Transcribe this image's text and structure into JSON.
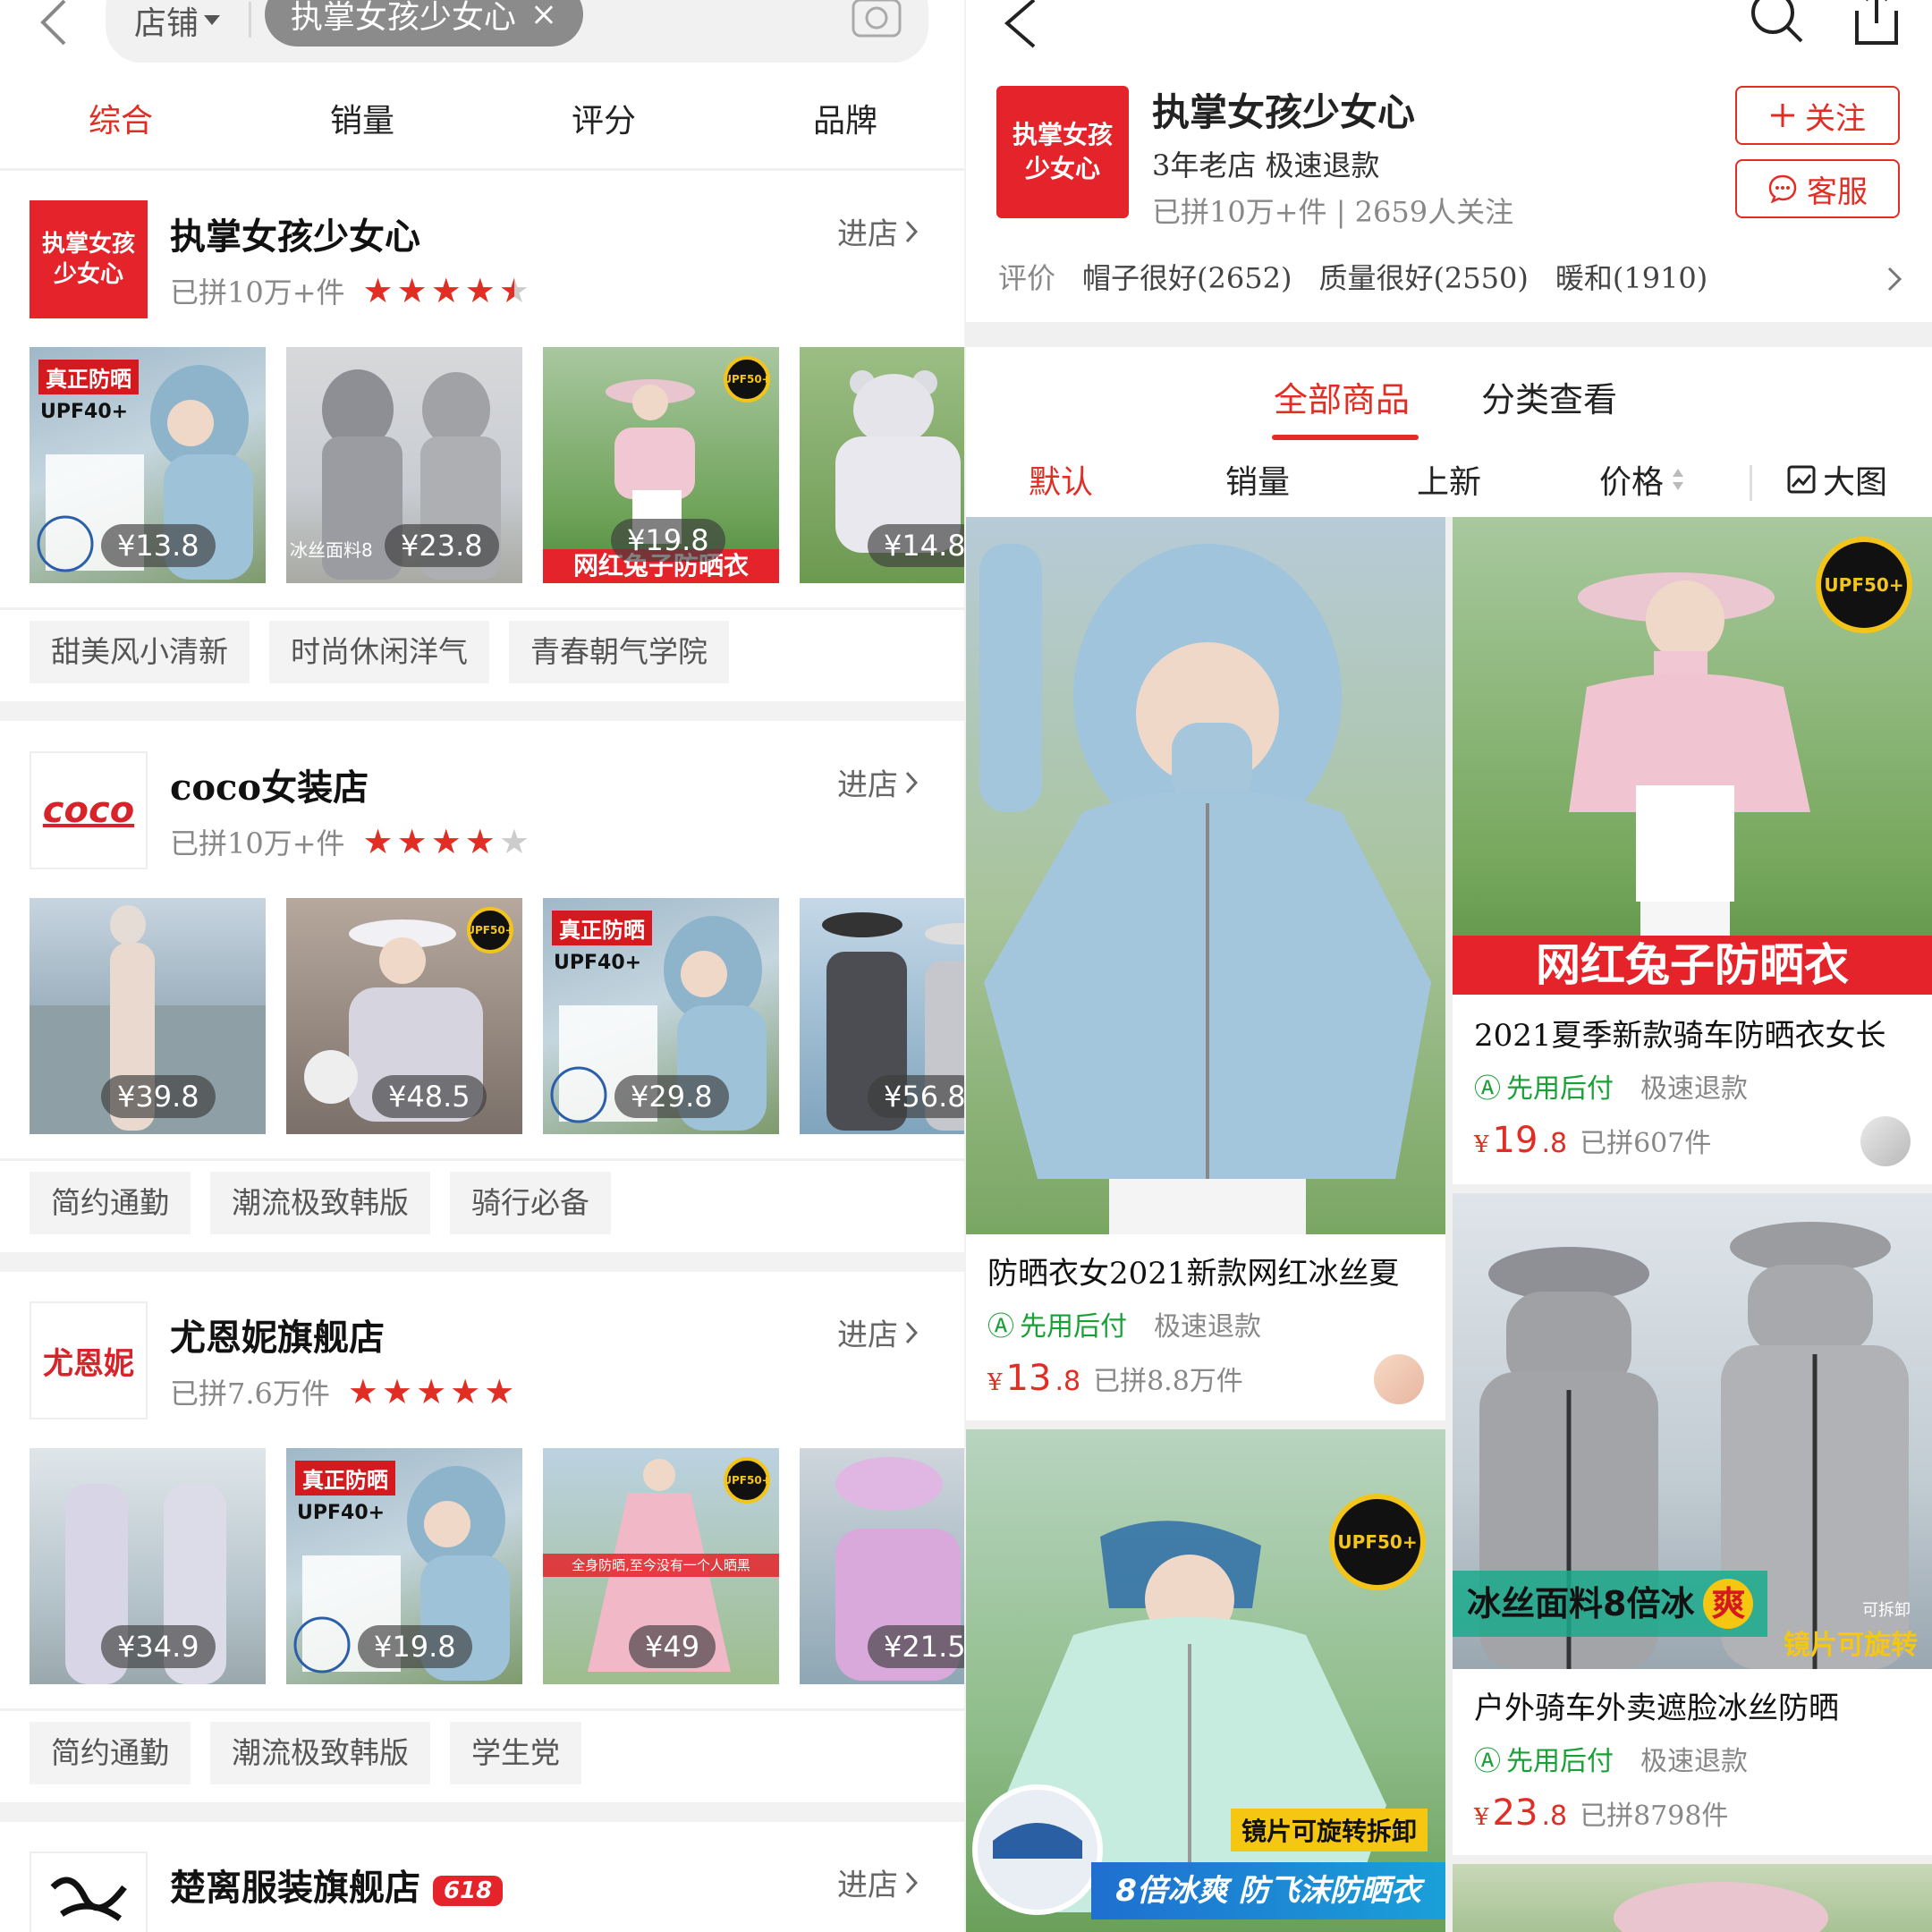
{
  "left": {
    "search": {
      "scope": "店铺",
      "query": "执掌女孩少女心",
      "clear": "×"
    },
    "sort_tabs": [
      {
        "label": "综合",
        "active": true
      },
      {
        "label": "销量",
        "active": false
      },
      {
        "label": "评分",
        "active": false
      },
      {
        "label": "品牌",
        "active": false
      }
    ],
    "stores": [
      {
        "name": "执掌女孩少女心",
        "logo_line1": "执掌女孩",
        "logo_line2": "少女心",
        "sales": "已拼10万+件",
        "rating": 4.5,
        "enter": "进店",
        "products": [
          {
            "price": "¥13.8",
            "badge": "真正防晒",
            "upf": "UPF40+"
          },
          {
            "price": "¥23.8",
            "caption": "冰丝面料8"
          },
          {
            "price": "¥19.8",
            "strip": "网红兔子防晒衣",
            "seal": "UPF50+"
          },
          {
            "price": "¥14.8"
          }
        ],
        "tags": [
          "甜美风小清新",
          "时尚休闲洋气",
          "青春朝气学院"
        ]
      },
      {
        "name": "coco女装店",
        "logo_text": "coco",
        "sales": "已拼10万+件",
        "rating": 4,
        "enter": "进店",
        "products": [
          {
            "price": "¥39.8"
          },
          {
            "price": "¥48.5",
            "seal": "UPF50+"
          },
          {
            "price": "¥29.8",
            "badge": "真正防晒",
            "upf": "UPF40+"
          },
          {
            "price": "¥56.8"
          }
        ],
        "tags": [
          "简约通勤",
          "潮流极致韩版",
          "骑行必备"
        ]
      },
      {
        "name": "尤恩妮旗舰店",
        "logo_text": "尤恩妮",
        "sales": "已拼7.6万件",
        "rating": 5,
        "enter": "进店",
        "products": [
          {
            "price": "¥34.9"
          },
          {
            "price": "¥19.8",
            "badge": "真正防晒",
            "upf": "UPF40+"
          },
          {
            "price": "¥49",
            "seal": "UPF50+",
            "caption": "全身防晒,至今没有一个人晒黑"
          },
          {
            "price": "¥21.5"
          }
        ],
        "tags": [
          "简约通勤",
          "潮流极致韩版",
          "学生党"
        ]
      },
      {
        "name": "楚离服装旗舰店",
        "badge": "618",
        "enter": "进店"
      }
    ]
  },
  "right": {
    "store": {
      "logo_line1": "执掌女孩",
      "logo_line2": "少女心",
      "name": "执掌女孩少女心",
      "subtitle": "3年老店 极速退款",
      "stats": "已拼10万+件 | 2659人关注",
      "follow": "关注",
      "service": "客服",
      "review_key": "评价",
      "reviews": [
        "帽子很好(2652)",
        "质量很好(2550)",
        "暖和(1910)"
      ]
    },
    "tabs": [
      {
        "label": "全部商品",
        "active": true
      },
      {
        "label": "分类查看",
        "active": false
      }
    ],
    "sort": [
      {
        "label": "默认",
        "active": true
      },
      {
        "label": "销量",
        "active": false
      },
      {
        "label": "上新",
        "active": false
      },
      {
        "label": "价格",
        "active": false
      }
    ],
    "view_label": "大图",
    "products": [
      {
        "title": "防晒衣女2021新款网红冰丝夏",
        "svc1": "先用后付",
        "svc2": "极速退款",
        "currency": "¥",
        "int": "13",
        "dec": ".8",
        "sold": "已拼8.8万件"
      },
      {
        "title": "2021夏季新款骑车防晒衣女长",
        "strip": "网红兔子防晒衣",
        "seal": "UPF50+",
        "svc1": "先用后付",
        "svc2": "极速退款",
        "currency": "¥",
        "int": "19",
        "dec": ".8",
        "sold": "已拼607件"
      },
      {
        "title": "户外骑车外卖遮脸冰丝防晒",
        "banner": "冰丝面料8倍冰",
        "banner_mark": "爽",
        "rotate": "镜片可旋转",
        "detach": "可拆卸",
        "svc1": "先用后付",
        "svc2": "极速退款",
        "currency": "¥",
        "int": "23",
        "dec": ".8",
        "sold": "已拼8798件"
      },
      {
        "seal": "UPF50+",
        "banner_top": "镜片可旋转拆卸",
        "banner_big": "8倍冰爽 防飞沫防晒衣"
      }
    ]
  },
  "colors": {
    "accent": "#e02e24",
    "green": "#1aa037",
    "gold": "#f3c51b"
  }
}
